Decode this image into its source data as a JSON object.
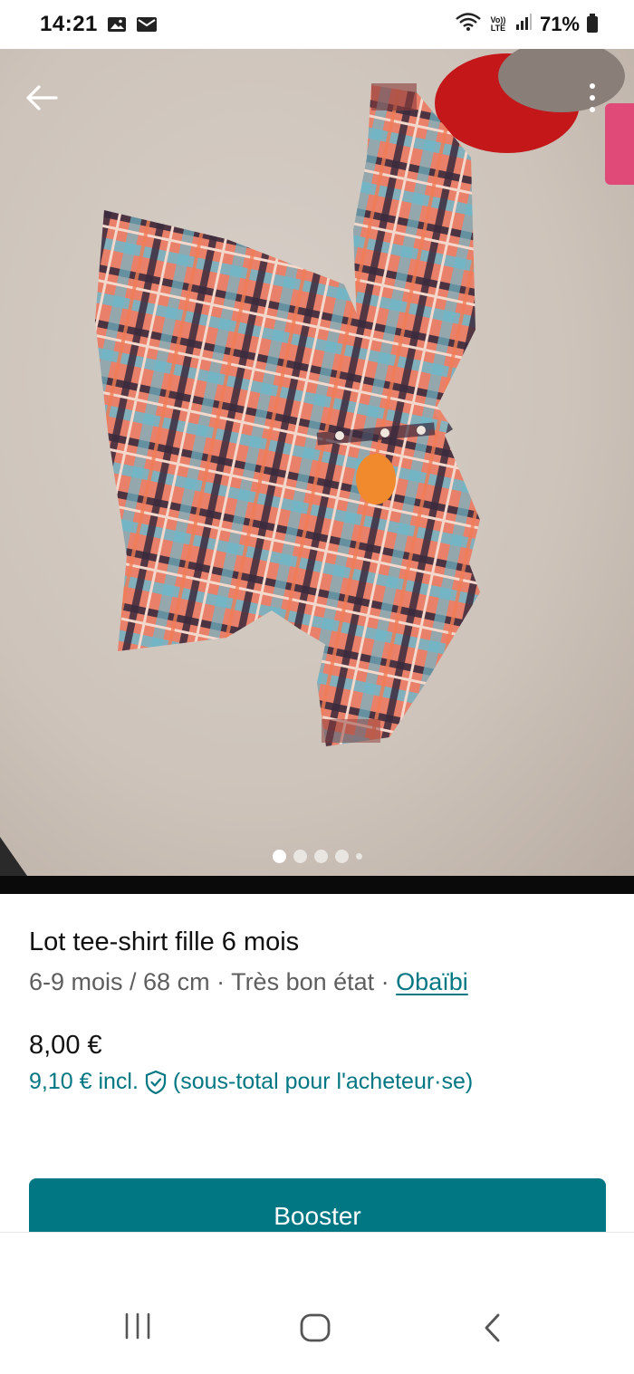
{
  "status_bar": {
    "time": "14:21",
    "network": "Vo)) LTE",
    "battery": "71%",
    "icons": [
      "image-icon",
      "mail-icon",
      "wifi-icon",
      "signal-icon",
      "battery-icon"
    ]
  },
  "photo": {
    "carousel": {
      "count": 5,
      "active_index": 0
    }
  },
  "listing": {
    "title": "Lot tee-shirt fille 6 mois",
    "size": "6-9 mois / 68 cm",
    "separator1": " · ",
    "condition": "Très bon état",
    "separator2": " · ",
    "brand": "Obaïbi",
    "price": "8,00 €",
    "price_incl": "9,10 € incl.",
    "price_incl_note": "(sous-total pour l'acheteur·se)"
  },
  "actions": {
    "booster_label": "Booster"
  },
  "colors": {
    "accent": "#007782",
    "text_primary": "#111111",
    "text_secondary": "#5e5e5e"
  }
}
